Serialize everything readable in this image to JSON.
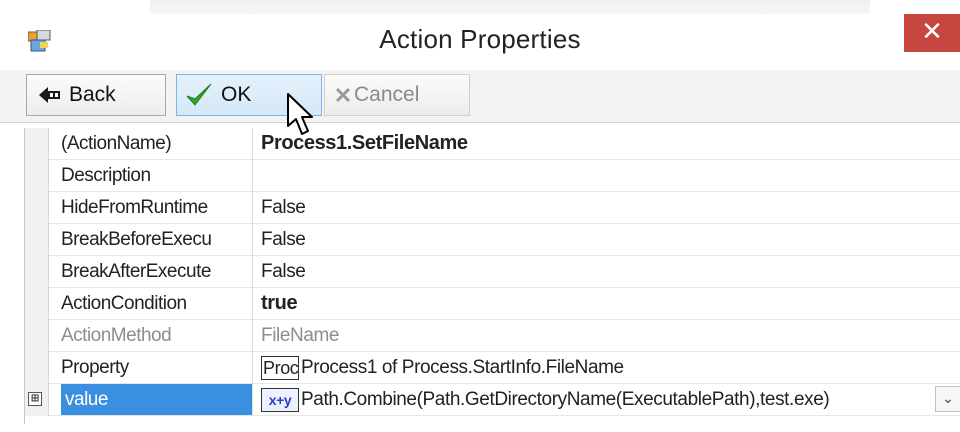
{
  "window": {
    "title": "Action Properties",
    "close_glyph": "✕"
  },
  "toolbar": {
    "back_label": "Back",
    "ok_label": "OK",
    "cancel_label": "Cancel"
  },
  "properties": [
    {
      "name": "(ActionName)",
      "value": "Process1.SetFileName",
      "style": "bold"
    },
    {
      "name": "Description",
      "value": ""
    },
    {
      "name": "HideFromRuntime",
      "value": "False"
    },
    {
      "name": "BreakBeforeExecu",
      "value": "False"
    },
    {
      "name": "BreakAfterExecute",
      "value": "False"
    },
    {
      "name": "ActionCondition",
      "value": "true",
      "style": "bold"
    },
    {
      "name": "ActionMethod",
      "value": "FileName",
      "style": "disabled"
    },
    {
      "name": "Property",
      "value_box": "Proc",
      "value": "Process1 of Process.StartInfo.FileName"
    },
    {
      "name": "value",
      "value_box": "x+y",
      "value": "Path.Combine(Path.GetDirectoryName(ExecutablePath),test.exe)",
      "selected": true,
      "expander": "⊞"
    }
  ],
  "colors": {
    "close_bg": "#c7453f",
    "selection_bg": "#3b8fe0",
    "ok_check": "#2fa82f"
  },
  "icons": [
    "app-icon",
    "back-arrow-icon",
    "checkmark-icon",
    "cancel-x-icon",
    "mouse-cursor-icon",
    "expand-plus-icon",
    "chevron-down-icon"
  ]
}
